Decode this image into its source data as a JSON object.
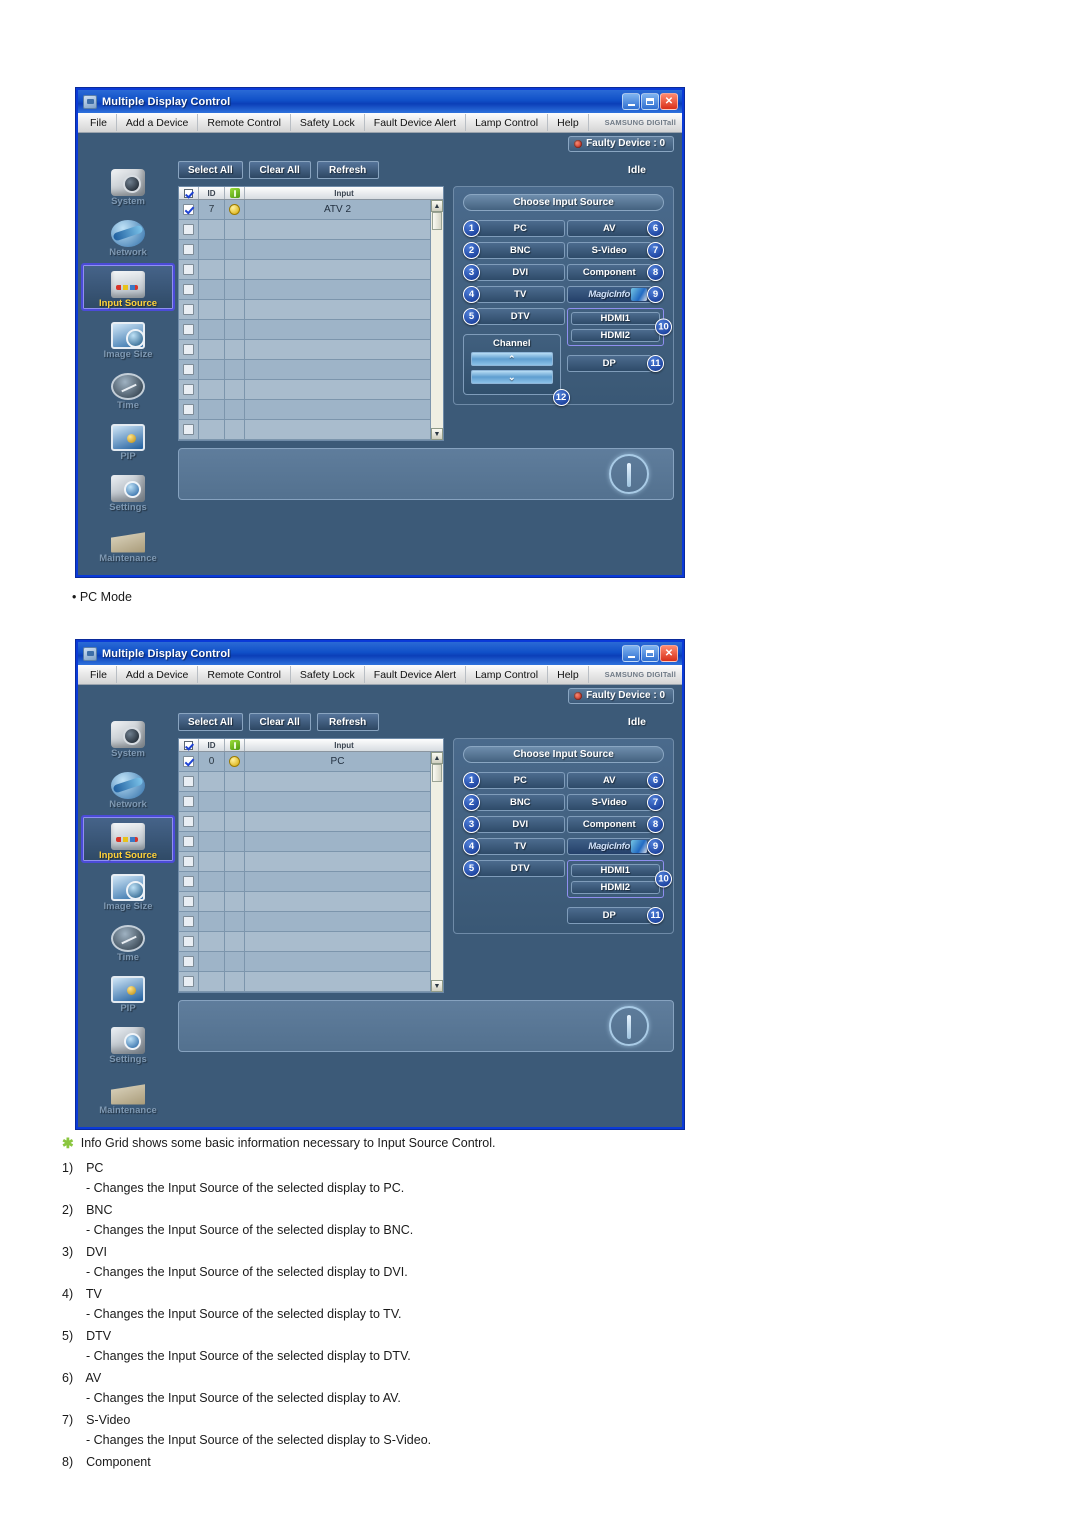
{
  "window": {
    "title": "Multiple Display Control",
    "titlebar_icon": "app-window-icon",
    "controls": {
      "minimize": "_",
      "maximize": "▫",
      "close": "✕"
    },
    "menu": [
      "File",
      "Add a Device",
      "Remote Control",
      "Safety Lock",
      "Fault Device Alert",
      "Lamp Control",
      "Help"
    ],
    "brand_logo": "SAMSUNG DIGITall",
    "faulty_device": "Faulty Device : 0",
    "status": "Idle"
  },
  "sidebar": {
    "items": [
      {
        "label": "System",
        "icon": "camera-system-icon",
        "active": false
      },
      {
        "label": "Network",
        "icon": "globe-network-icon",
        "active": false
      },
      {
        "label": "Input Source",
        "icon": "input-source-icon",
        "active": true
      },
      {
        "label": "Image Size",
        "icon": "monitor-image-size-icon",
        "active": false
      },
      {
        "label": "Time",
        "icon": "clock-time-icon",
        "active": false
      },
      {
        "label": "PIP",
        "icon": "picture-in-picture-icon",
        "active": false
      },
      {
        "label": "Settings",
        "icon": "cube-settings-icon",
        "active": false
      },
      {
        "label": "Maintenance",
        "icon": "toolbox-maintenance-icon",
        "active": false
      }
    ]
  },
  "toolbar": {
    "select_all": "Select All",
    "clear_all": "Clear All",
    "refresh": "Refresh"
  },
  "grid": {
    "headers": {
      "check": "select-all-checkbox",
      "id": "ID",
      "power": "power-status-icon",
      "input": "Input"
    },
    "empty_row_count": 11,
    "scrollbar": {
      "up": "▲",
      "down": "▼"
    }
  },
  "input_panel": {
    "title": "Choose Input Source",
    "left_column": [
      {
        "num": "1",
        "label": "PC"
      },
      {
        "num": "2",
        "label": "BNC"
      },
      {
        "num": "3",
        "label": "DVI"
      },
      {
        "num": "4",
        "label": "TV"
      },
      {
        "num": "5",
        "label": "DTV"
      }
    ],
    "right_column": [
      {
        "num": "6",
        "label": "AV"
      },
      {
        "num": "7",
        "label": "S-Video"
      },
      {
        "num": "8",
        "label": "Component"
      },
      {
        "num": "9",
        "label": "MagicInfo"
      }
    ],
    "hdmi_group": {
      "num": "10",
      "items": [
        "HDMI1",
        "HDMI2"
      ]
    },
    "dp": {
      "num": "11",
      "label": "DP"
    },
    "channel": {
      "num": "12",
      "title": "Channel",
      "up": "⌃",
      "down": "⌄"
    }
  },
  "window1": {
    "row": {
      "id": "7",
      "input": "ATV 2"
    },
    "has_channel": true
  },
  "window2": {
    "row": {
      "id": "0",
      "input": "PC"
    },
    "has_channel": false
  },
  "caption": "• PC Mode",
  "notes": {
    "intro": "Info Grid shows some basic information necessary to Input Source Control.",
    "items": [
      {
        "num": "1)",
        "name": "PC",
        "desc": "- Changes the Input Source of the selected display to PC."
      },
      {
        "num": "2)",
        "name": "BNC",
        "desc": "- Changes the Input Source of the selected display to BNC."
      },
      {
        "num": "3)",
        "name": "DVI",
        "desc": "- Changes the Input Source of the selected display to DVI."
      },
      {
        "num": "4)",
        "name": "TV",
        "desc": "- Changes the Input Source of the selected display to TV."
      },
      {
        "num": "5)",
        "name": "DTV",
        "desc": "- Changes the Input Source of the selected display to DTV."
      },
      {
        "num": "6)",
        "name": "AV",
        "desc": "- Changes the Input Source of the selected display to AV."
      },
      {
        "num": "7)",
        "name": "S-Video",
        "desc": "- Changes the Input Source of the selected display to S-Video."
      },
      {
        "num": "8)",
        "name": "Component",
        "desc": ""
      }
    ]
  },
  "colors": {
    "window_bg": "#3c5a78",
    "title_blue": "#0b3fb8",
    "accent_yellow": "#ffd23a",
    "selection_purple": "#4b4bd8",
    "star_green": "#8ac63f"
  }
}
